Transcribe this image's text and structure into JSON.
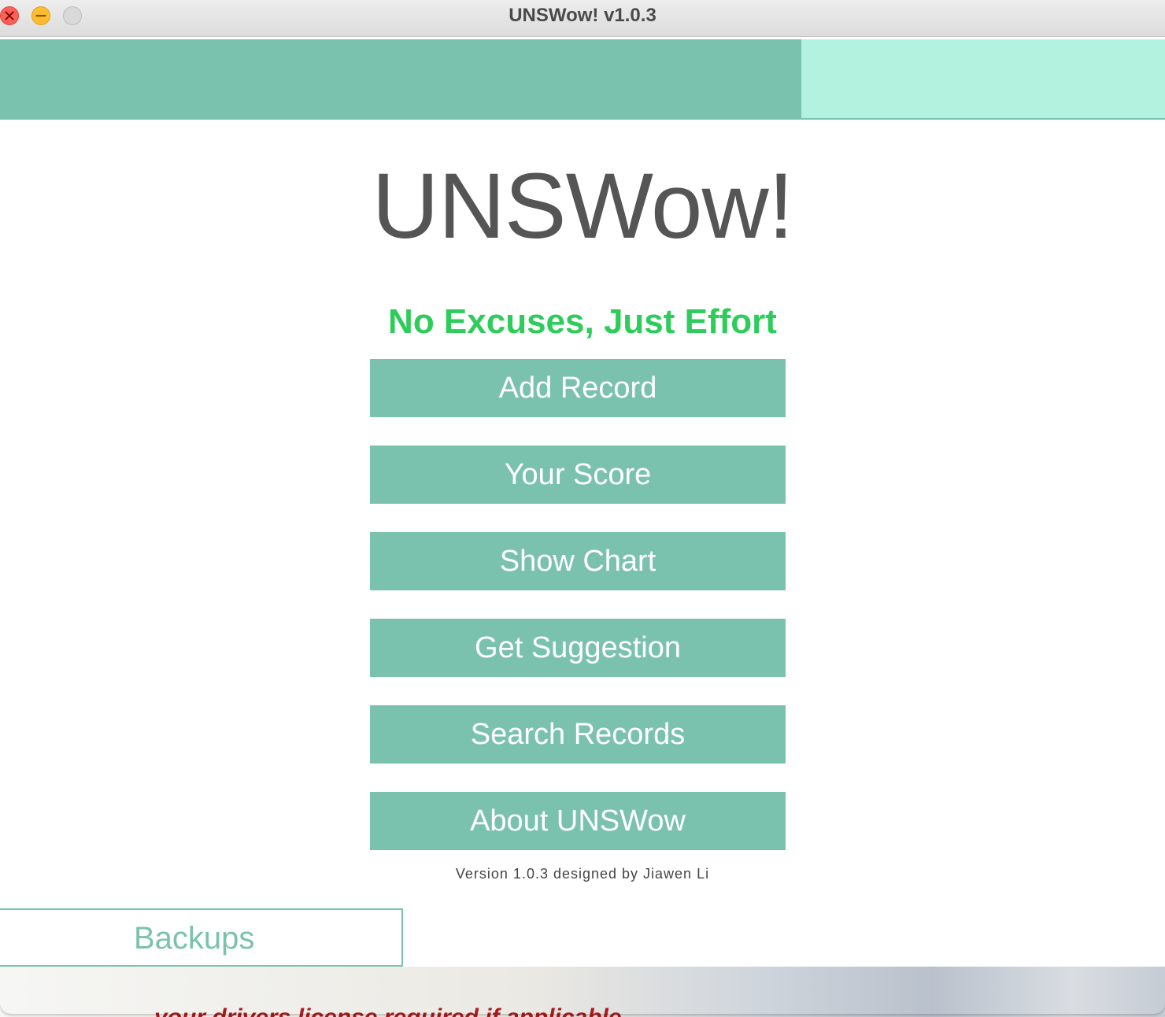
{
  "window": {
    "title": "UNSWow! v1.0.3"
  },
  "main": {
    "app_title": "UNSWow!",
    "slogan": "No Excuses, Just Effort",
    "buttons": [
      {
        "label": "Add Record"
      },
      {
        "label": "Your Score"
      },
      {
        "label": "Show Chart"
      },
      {
        "label": "Get Suggestion"
      },
      {
        "label": "Search Records"
      },
      {
        "label": "About UNSWow"
      }
    ],
    "version_text": "Version 1.0.3 designed by Jiawen Li"
  },
  "footer": {
    "backups_label": "Backups"
  },
  "background": {
    "partial_text": "your drivers license required if applicable"
  },
  "colors": {
    "accent": "#7bc2ae",
    "accent_light": "#b2f2de",
    "slogan": "#2ecc5a",
    "title_text": "#555555"
  },
  "icons": {
    "close": "close-icon",
    "minimize": "minimize-icon",
    "zoom": "zoom-icon"
  }
}
